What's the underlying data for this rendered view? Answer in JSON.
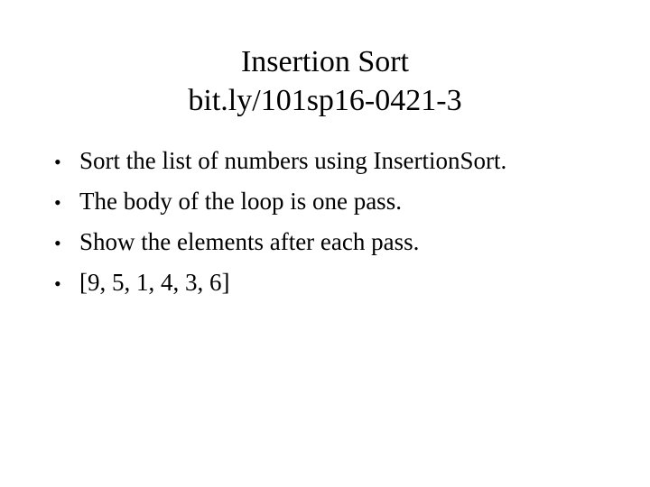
{
  "slide": {
    "background_color": "#ffffff",
    "text_color": "#000000",
    "title": {
      "line1": "Insertion Sort",
      "line2": "bit.ly/101sp16-0421-3"
    },
    "bullet_marker": "•",
    "bullets": [
      {
        "text": "Sort the list of numbers using InsertionSort."
      },
      {
        "text": "The body of the loop is one pass."
      },
      {
        "text": "Show the elements after each pass."
      },
      {
        "text": "[9, 5, 1, 4, 3, 6]"
      }
    ]
  }
}
